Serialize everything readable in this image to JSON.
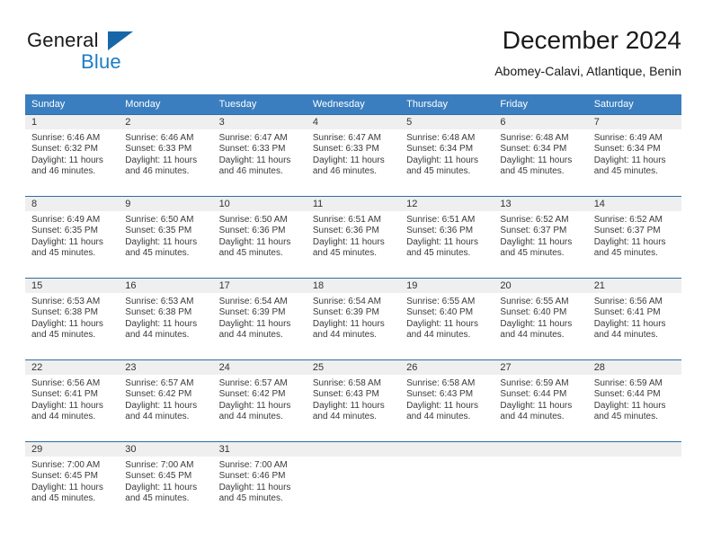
{
  "brand": {
    "name_part1": "General",
    "name_part2": "Blue",
    "flag_icon": "triangle-flag-icon"
  },
  "header": {
    "title": "December 2024",
    "subtitle": "Abomey-Calavi, Atlantique, Benin"
  },
  "colors": {
    "header_blue": "#3a7ebf",
    "rule_blue": "#2e6da4",
    "band_gray": "#efefef",
    "brand_blue": "#1c7cc6",
    "flag_blue": "#1767a8"
  },
  "weekdays": [
    "Sunday",
    "Monday",
    "Tuesday",
    "Wednesday",
    "Thursday",
    "Friday",
    "Saturday"
  ],
  "weeks": [
    [
      {
        "day": "1",
        "sunrise": "Sunrise: 6:46 AM",
        "sunset": "Sunset: 6:32 PM",
        "daylight_line1": "Daylight: 11 hours",
        "daylight_line2": "and 46 minutes."
      },
      {
        "day": "2",
        "sunrise": "Sunrise: 6:46 AM",
        "sunset": "Sunset: 6:33 PM",
        "daylight_line1": "Daylight: 11 hours",
        "daylight_line2": "and 46 minutes."
      },
      {
        "day": "3",
        "sunrise": "Sunrise: 6:47 AM",
        "sunset": "Sunset: 6:33 PM",
        "daylight_line1": "Daylight: 11 hours",
        "daylight_line2": "and 46 minutes."
      },
      {
        "day": "4",
        "sunrise": "Sunrise: 6:47 AM",
        "sunset": "Sunset: 6:33 PM",
        "daylight_line1": "Daylight: 11 hours",
        "daylight_line2": "and 46 minutes."
      },
      {
        "day": "5",
        "sunrise": "Sunrise: 6:48 AM",
        "sunset": "Sunset: 6:34 PM",
        "daylight_line1": "Daylight: 11 hours",
        "daylight_line2": "and 45 minutes."
      },
      {
        "day": "6",
        "sunrise": "Sunrise: 6:48 AM",
        "sunset": "Sunset: 6:34 PM",
        "daylight_line1": "Daylight: 11 hours",
        "daylight_line2": "and 45 minutes."
      },
      {
        "day": "7",
        "sunrise": "Sunrise: 6:49 AM",
        "sunset": "Sunset: 6:34 PM",
        "daylight_line1": "Daylight: 11 hours",
        "daylight_line2": "and 45 minutes."
      }
    ],
    [
      {
        "day": "8",
        "sunrise": "Sunrise: 6:49 AM",
        "sunset": "Sunset: 6:35 PM",
        "daylight_line1": "Daylight: 11 hours",
        "daylight_line2": "and 45 minutes."
      },
      {
        "day": "9",
        "sunrise": "Sunrise: 6:50 AM",
        "sunset": "Sunset: 6:35 PM",
        "daylight_line1": "Daylight: 11 hours",
        "daylight_line2": "and 45 minutes."
      },
      {
        "day": "10",
        "sunrise": "Sunrise: 6:50 AM",
        "sunset": "Sunset: 6:36 PM",
        "daylight_line1": "Daylight: 11 hours",
        "daylight_line2": "and 45 minutes."
      },
      {
        "day": "11",
        "sunrise": "Sunrise: 6:51 AM",
        "sunset": "Sunset: 6:36 PM",
        "daylight_line1": "Daylight: 11 hours",
        "daylight_line2": "and 45 minutes."
      },
      {
        "day": "12",
        "sunrise": "Sunrise: 6:51 AM",
        "sunset": "Sunset: 6:36 PM",
        "daylight_line1": "Daylight: 11 hours",
        "daylight_line2": "and 45 minutes."
      },
      {
        "day": "13",
        "sunrise": "Sunrise: 6:52 AM",
        "sunset": "Sunset: 6:37 PM",
        "daylight_line1": "Daylight: 11 hours",
        "daylight_line2": "and 45 minutes."
      },
      {
        "day": "14",
        "sunrise": "Sunrise: 6:52 AM",
        "sunset": "Sunset: 6:37 PM",
        "daylight_line1": "Daylight: 11 hours",
        "daylight_line2": "and 45 minutes."
      }
    ],
    [
      {
        "day": "15",
        "sunrise": "Sunrise: 6:53 AM",
        "sunset": "Sunset: 6:38 PM",
        "daylight_line1": "Daylight: 11 hours",
        "daylight_line2": "and 45 minutes."
      },
      {
        "day": "16",
        "sunrise": "Sunrise: 6:53 AM",
        "sunset": "Sunset: 6:38 PM",
        "daylight_line1": "Daylight: 11 hours",
        "daylight_line2": "and 44 minutes."
      },
      {
        "day": "17",
        "sunrise": "Sunrise: 6:54 AM",
        "sunset": "Sunset: 6:39 PM",
        "daylight_line1": "Daylight: 11 hours",
        "daylight_line2": "and 44 minutes."
      },
      {
        "day": "18",
        "sunrise": "Sunrise: 6:54 AM",
        "sunset": "Sunset: 6:39 PM",
        "daylight_line1": "Daylight: 11 hours",
        "daylight_line2": "and 44 minutes."
      },
      {
        "day": "19",
        "sunrise": "Sunrise: 6:55 AM",
        "sunset": "Sunset: 6:40 PM",
        "daylight_line1": "Daylight: 11 hours",
        "daylight_line2": "and 44 minutes."
      },
      {
        "day": "20",
        "sunrise": "Sunrise: 6:55 AM",
        "sunset": "Sunset: 6:40 PM",
        "daylight_line1": "Daylight: 11 hours",
        "daylight_line2": "and 44 minutes."
      },
      {
        "day": "21",
        "sunrise": "Sunrise: 6:56 AM",
        "sunset": "Sunset: 6:41 PM",
        "daylight_line1": "Daylight: 11 hours",
        "daylight_line2": "and 44 minutes."
      }
    ],
    [
      {
        "day": "22",
        "sunrise": "Sunrise: 6:56 AM",
        "sunset": "Sunset: 6:41 PM",
        "daylight_line1": "Daylight: 11 hours",
        "daylight_line2": "and 44 minutes."
      },
      {
        "day": "23",
        "sunrise": "Sunrise: 6:57 AM",
        "sunset": "Sunset: 6:42 PM",
        "daylight_line1": "Daylight: 11 hours",
        "daylight_line2": "and 44 minutes."
      },
      {
        "day": "24",
        "sunrise": "Sunrise: 6:57 AM",
        "sunset": "Sunset: 6:42 PM",
        "daylight_line1": "Daylight: 11 hours",
        "daylight_line2": "and 44 minutes."
      },
      {
        "day": "25",
        "sunrise": "Sunrise: 6:58 AM",
        "sunset": "Sunset: 6:43 PM",
        "daylight_line1": "Daylight: 11 hours",
        "daylight_line2": "and 44 minutes."
      },
      {
        "day": "26",
        "sunrise": "Sunrise: 6:58 AM",
        "sunset": "Sunset: 6:43 PM",
        "daylight_line1": "Daylight: 11 hours",
        "daylight_line2": "and 44 minutes."
      },
      {
        "day": "27",
        "sunrise": "Sunrise: 6:59 AM",
        "sunset": "Sunset: 6:44 PM",
        "daylight_line1": "Daylight: 11 hours",
        "daylight_line2": "and 44 minutes."
      },
      {
        "day": "28",
        "sunrise": "Sunrise: 6:59 AM",
        "sunset": "Sunset: 6:44 PM",
        "daylight_line1": "Daylight: 11 hours",
        "daylight_line2": "and 45 minutes."
      }
    ],
    [
      {
        "day": "29",
        "sunrise": "Sunrise: 7:00 AM",
        "sunset": "Sunset: 6:45 PM",
        "daylight_line1": "Daylight: 11 hours",
        "daylight_line2": "and 45 minutes."
      },
      {
        "day": "30",
        "sunrise": "Sunrise: 7:00 AM",
        "sunset": "Sunset: 6:45 PM",
        "daylight_line1": "Daylight: 11 hours",
        "daylight_line2": "and 45 minutes."
      },
      {
        "day": "31",
        "sunrise": "Sunrise: 7:00 AM",
        "sunset": "Sunset: 6:46 PM",
        "daylight_line1": "Daylight: 11 hours",
        "daylight_line2": "and 45 minutes."
      },
      {
        "day": "",
        "sunrise": "",
        "sunset": "",
        "daylight_line1": "",
        "daylight_line2": ""
      },
      {
        "day": "",
        "sunrise": "",
        "sunset": "",
        "daylight_line1": "",
        "daylight_line2": ""
      },
      {
        "day": "",
        "sunrise": "",
        "sunset": "",
        "daylight_line1": "",
        "daylight_line2": ""
      },
      {
        "day": "",
        "sunrise": "",
        "sunset": "",
        "daylight_line1": "",
        "daylight_line2": ""
      }
    ]
  ]
}
